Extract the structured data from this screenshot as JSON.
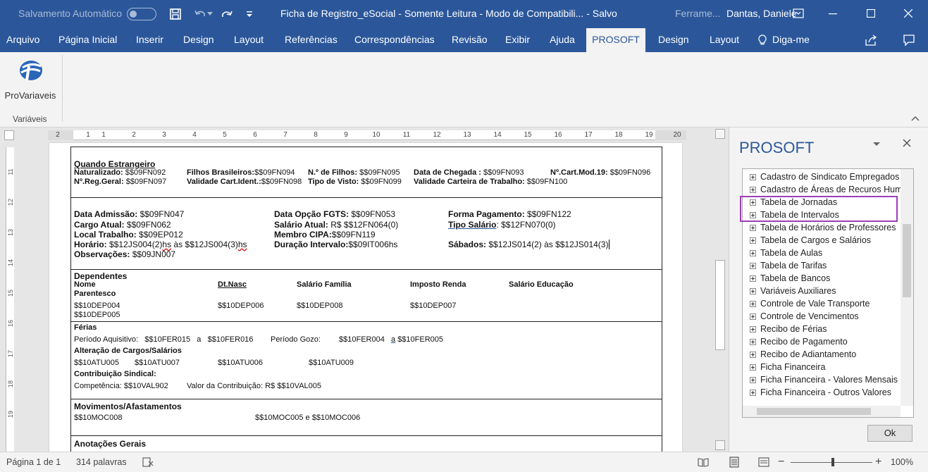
{
  "titlebar": {
    "autosave_label": "Salvamento Automático",
    "doc_title": "Ficha de Registro_eSocial  -  Somente Leitura  -  Modo de Compatibili...  -  Salvo",
    "tools_label": "Ferrame...",
    "user_name": "Dantas, Daniele"
  },
  "tabs": [
    {
      "label": "Arquivo"
    },
    {
      "label": "Página Inicial"
    },
    {
      "label": "Inserir"
    },
    {
      "label": "Design"
    },
    {
      "label": "Layout"
    },
    {
      "label": "Referências"
    },
    {
      "label": "Correspondências"
    },
    {
      "label": "Revisão"
    },
    {
      "label": "Exibir"
    },
    {
      "label": "Ajuda"
    },
    {
      "label": "PROSOFT"
    },
    {
      "label": "Design"
    },
    {
      "label": "Layout"
    },
    {
      "label": "Diga-me"
    }
  ],
  "ribbon": {
    "button_label": "ProVariaveis",
    "group_label": "Variáveis"
  },
  "hruler_numbers": [
    "2",
    "1",
    "1",
    "2",
    "3",
    "4",
    "5",
    "6",
    "7",
    "8",
    "9",
    "10",
    "11",
    "12",
    "13",
    "14",
    "15",
    "16",
    "17",
    "18",
    "19",
    "20"
  ],
  "vruler_numbers": [
    "11",
    "12",
    "13",
    "14",
    "15",
    "16",
    "17",
    "18",
    "19"
  ],
  "document": {
    "s1": {
      "title": "Quando Estrangeiro",
      "naturalizado_lbl": "Naturalizado:",
      "naturalizado_val": " $$09FN092",
      "filhos_br_lbl": "Filhos Brasileiros:",
      "filhos_br_val": "$$09FN094",
      "nfilhos_lbl": "N.º de Filhos:",
      "nfilhos_val": " $$09FN095",
      "chegada_lbl": "Data de Chegada :",
      "chegada_val": " $$09FN093",
      "cartmod_lbl": "Nº.Cart.Mod.19:",
      "cartmod_val": "  $$09FN096",
      "nreg_lbl": "Nº.Reg.Geral:",
      "nreg_val": " $$09FN097",
      "validade_lbl": "Validade Cart.Ident.:",
      "validade_val": "$$09FN098",
      "visto_lbl": "Tipo de Visto:",
      "visto_val": " $$09FN099",
      "valtrab_lbl": "Validade Carteira de Trabalho:",
      "valtrab_val": " $$09FN100"
    },
    "s2": {
      "admissao_lbl": "Data Admissão:",
      "admissao_val": " $$09FN047",
      "opcao_lbl": "Data Opção FGTS:",
      "opcao_val": "  $$09FN053",
      "forma_lbl": "Forma Pagamento:",
      "forma_val": " $$09FN122",
      "cargo_lbl": "Cargo Atual:",
      "cargo_val": " $$09FN062",
      "salario_lbl": "Salário Atual:",
      "salario_val": " R$ $$12FN064(0)",
      "tiposal_lbl": "Tipo  Salário",
      "tiposal_val": ": $$12FN070(0)",
      "local_lbl": "Local Trabalho:",
      "local_val": " $$09EP012",
      "cipa_lbl": "Membro CIPA:",
      "cipa_val": "$$09FN119",
      "horario_lbl": "Horário:",
      "horario_val_a": " $$12JS004(2)",
      "horario_hs1": "hs",
      "horario_mid": " às $$12JS004(3)",
      "horario_hs2": "hs",
      "duracao_lbl": "Duração Intervalo:",
      "duracao_val": "$$09IT006hs",
      "sabados_lbl": "Sábados:",
      "sabados_val": "  $$12JS014(2) às $$12JS014(3)",
      "obs_lbl": "Observações:",
      "obs_val": " $$09JN007"
    },
    "s3": {
      "title": "Dependentes",
      "col_nome": "Nome",
      "col_nasc": "Dt.Nasc",
      "col_salfam": "Salário Família",
      "col_ir": "Imposto Renda",
      "col_saled": "Salário Educação",
      "col_parent": "Parentesco",
      "r1_nome": "$$10DEP004",
      "r1_nasc": "$$10DEP006",
      "r1_salfam": "$$10DEP008",
      "r1_ir": "$$10DEP007",
      "r2_nome": "$$10DEP005"
    },
    "s4": {
      "ferias_title": "Férias",
      "periodo_aq_lbl": "Período Aquisitivo:",
      "periodo_aq_val1": "$$10FER015",
      "a1": "a",
      "periodo_aq_val2": "$$10FER016",
      "periodo_gozo_lbl": "Período Gozo:",
      "periodo_gozo_val1": "$$10FER004",
      "a2": "a",
      "periodo_gozo_val2": " $$10FER005",
      "alter_title": "Alteração de Cargos/Salários",
      "atu1": "$$10ATU005",
      "atu2": "$$10ATU007",
      "atu3": "$$10ATU006",
      "atu4": "$$10ATU009",
      "contrib_title": "Contribuição Sindical:",
      "comp_lbl": "Competência:",
      "comp_val": " $$10VAL902",
      "valor_lbl": "Valor da Contribuição:",
      "valor_val": " R$ $$10VAL005"
    },
    "s5": {
      "title": "Movimentos/Afastamentos",
      "mov1": "$$10MOC008",
      "mov2": "$$10MOC005 e $$10MOC006"
    },
    "s6": {
      "title": "Anotações Gerais"
    }
  },
  "pane": {
    "title": "PROSOFT",
    "items": [
      {
        "label": "Cadastro de Sindicato Empregados"
      },
      {
        "label": "Cadastro de Áreas de Recuros Hum"
      },
      {
        "label": "Tabela de Jornadas"
      },
      {
        "label": "Tabela de Intervalos"
      },
      {
        "label": "Tabela de Horários de Professores"
      },
      {
        "label": "Tabela de Cargos e Salários"
      },
      {
        "label": "Tabela de Aulas"
      },
      {
        "label": "Tabela de Tarifas"
      },
      {
        "label": "Tabela de Bancos"
      },
      {
        "label": "Variáveis Auxiliares"
      },
      {
        "label": "Controle de Vale Transporte"
      },
      {
        "label": "Controle de Vencimentos"
      },
      {
        "label": "Recibo de Férias"
      },
      {
        "label": "Recibo de Pagamento"
      },
      {
        "label": "Recibo de Adiantamento"
      },
      {
        "label": "Ficha Financeira"
      },
      {
        "label": "Ficha Financeira - Valores Mensais"
      },
      {
        "label": "Ficha Financeira - Outros  Valores"
      }
    ],
    "ok_label": "Ok"
  },
  "status": {
    "page": "Página 1 de 1",
    "words": "314 palavras",
    "zoom": "100%"
  },
  "colors": {
    "accent": "#2b579a",
    "highlight_border": "#9b3fb5"
  }
}
